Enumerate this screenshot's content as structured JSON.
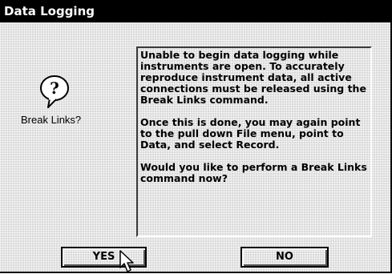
{
  "window": {
    "title": "Data Logging"
  },
  "icon": {
    "name": "question-balloon-icon",
    "glyph": "?",
    "label": "Break Links?"
  },
  "message": {
    "paragraphs": [
      "Unable to begin data logging while instruments are open.  To accurately reproduce instrument data, all active connections must be released using the Break Links command.",
      "Once this is done, you may again point to the pull down File menu, point to Data, and select Record.",
      "Would you like to perform a Break Links command now?"
    ]
  },
  "buttons": {
    "yes_label": "YES",
    "no_label": "NO"
  }
}
